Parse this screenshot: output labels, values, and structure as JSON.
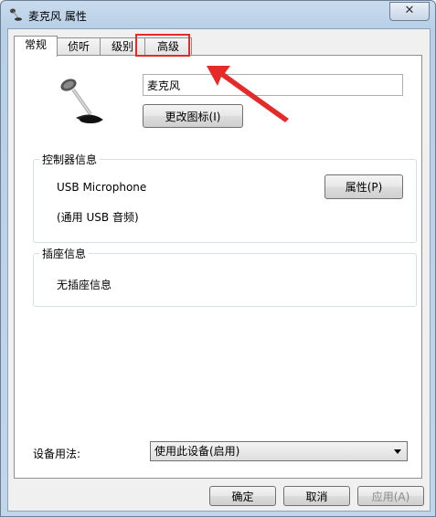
{
  "window": {
    "title": "麦克风 属性",
    "close_glyph": "✕"
  },
  "tabs": [
    {
      "label": "常规",
      "active": true
    },
    {
      "label": "侦听",
      "active": false
    },
    {
      "label": "级别",
      "active": false
    },
    {
      "label": "高级",
      "active": false
    }
  ],
  "general": {
    "device_name": "麦克风",
    "change_icon_label": "更改图标(I)",
    "controller": {
      "title": "控制器信息",
      "name": "USB Microphone",
      "description": "(通用 USB 音频)",
      "properties_label": "属性(P)"
    },
    "jack": {
      "title": "插座信息",
      "text": "无插座信息"
    },
    "usage": {
      "label": "设备用法:",
      "selected": "使用此设备(启用)"
    }
  },
  "footer": {
    "ok_label": "确定",
    "cancel_label": "取消",
    "apply_label": "应用(A)"
  },
  "annotation": {
    "color": "#e52a2a"
  }
}
